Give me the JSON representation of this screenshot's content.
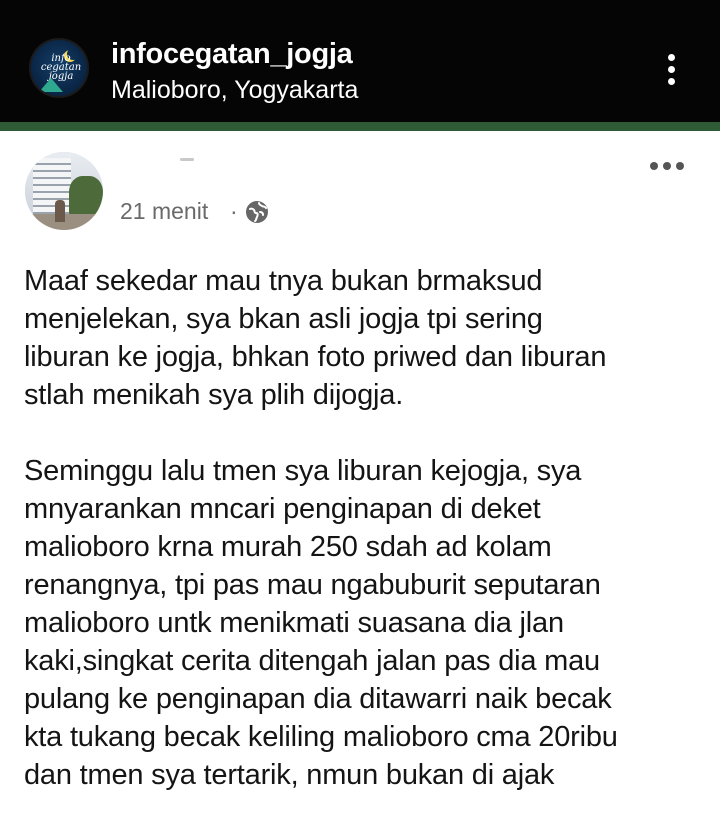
{
  "header": {
    "account_name": "infocegatan_jogja",
    "location": "Malioboro, Yogyakarta",
    "logo_text": "info cegatan jogja",
    "menu_icon": "vertical-dots-icon"
  },
  "post": {
    "time": "21 menit",
    "separator": "·",
    "privacy_icon": "globe-icon",
    "more_icon": "horizontal-dots-icon",
    "paragraph_1": [
      "Maaf sekedar mau tnya bukan brmaksud",
      "menjelekan, sya bkan asli jogja tpi sering",
      "liburan ke jogja, bhkan foto priwed dan liburan",
      "stlah menikah sya plih dijogja."
    ],
    "paragraph_2": [
      "Seminggu lalu tmen sya liburan kejogja, sya",
      "mnyarankan mncari penginapan di deket",
      "malioboro krna murah 250 sdah ad kolam",
      "renangnya, tpi pas mau ngabuburit seputaran",
      "malioboro untk menikmati suasana dia jlan",
      "kaki,singkat cerita ditengah jalan pas dia mau",
      "pulang ke penginapan dia ditawarri naik becak",
      "kta tukang becak keliling malioboro cma 20ribu",
      "dan tmen sya tertarik, nmun bukan di ajak"
    ]
  },
  "colors": {
    "header_bg": "#050505",
    "accent_bar": "#2f5a36",
    "body_text": "#141414",
    "meta_text": "#6a6a6a"
  }
}
